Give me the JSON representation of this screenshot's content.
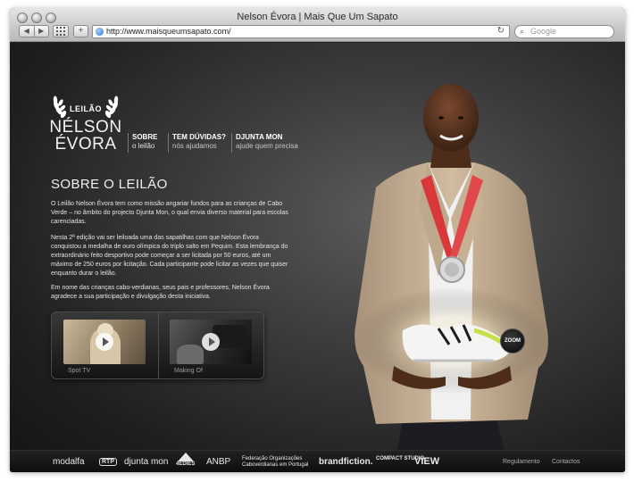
{
  "browser": {
    "title": "Nelson Évora | Mais Que Um Sapato",
    "url": "http://www.maisqueumsapato.com/",
    "search_placeholder": "Google",
    "back_glyph": "◀",
    "forward_glyph": "▶",
    "add_glyph": "+",
    "reload_glyph": "↻",
    "icons": [
      "traffic-light",
      "back-arrow",
      "forward-arrow",
      "grid",
      "add-bookmark",
      "globe",
      "reload",
      "search"
    ]
  },
  "logo": {
    "leilao": "LEILÃO",
    "name_line1": "NÉLSON",
    "name_line2": "ÉVORA"
  },
  "nav": [
    {
      "title": "SOBRE",
      "subtitle": "o leilão",
      "active": true
    },
    {
      "title": "TEM DÚVIDAS?",
      "subtitle": "nós ajudamos",
      "active": false
    },
    {
      "title": "DJUNTA MON",
      "subtitle": "ajude quem precisa",
      "active": false
    }
  ],
  "content": {
    "heading": "SOBRE O LEILÃO",
    "paragraph1": "O Leilão Nelson Évora tem como missão angariar fundos para as crianças de Cabo Verde – no âmbito do projecto Djunta Mon, o qual envia diverso material para escolas carenciadas.",
    "paragraph2": "Nesta 2ª edição vai ser leiloada uma das sapatilhas com que Nelson Évora conquistou a medalha de ouro olímpica do triplo salto em Pequim. Esta lembrança do extraordinário feito desportivo pode começar a ser licitada por 50 euros, até um máximo de 250 euros por licitação. Cada participante pode licitar as vezes que quiser enquanto durar o leilão.",
    "paragraph3": "Em nome das crianças cabo-verdianas, seus pais e professores, Nelson Évora agradece a sua participação e divulgação desta iniciativa."
  },
  "videos": [
    {
      "label": "Spot TV"
    },
    {
      "label": "Making Of"
    }
  ],
  "zoom_label": "ZOOM",
  "sponsors": {
    "modalfa": "modalfa",
    "rtp": "RTP",
    "djuntamon": "djunta mon",
    "tagides": "4EDIES",
    "anbp": "ANBP",
    "federacao_line1": "Federação Organizações",
    "federacao_line2": "Caboverdianas em Portugal",
    "brandfiction": "brandfiction.",
    "compact": "COMPACT STUDIO",
    "view": "VIEW"
  },
  "footer_links": {
    "regulamento": "Regulamento",
    "contactos": "Contactos"
  },
  "colors": {
    "page_bg": "#2c2c2c",
    "medal_ribbon": "#d8383a",
    "suit": "#cdb79a",
    "shoe_accent": "#c6e04a"
  }
}
